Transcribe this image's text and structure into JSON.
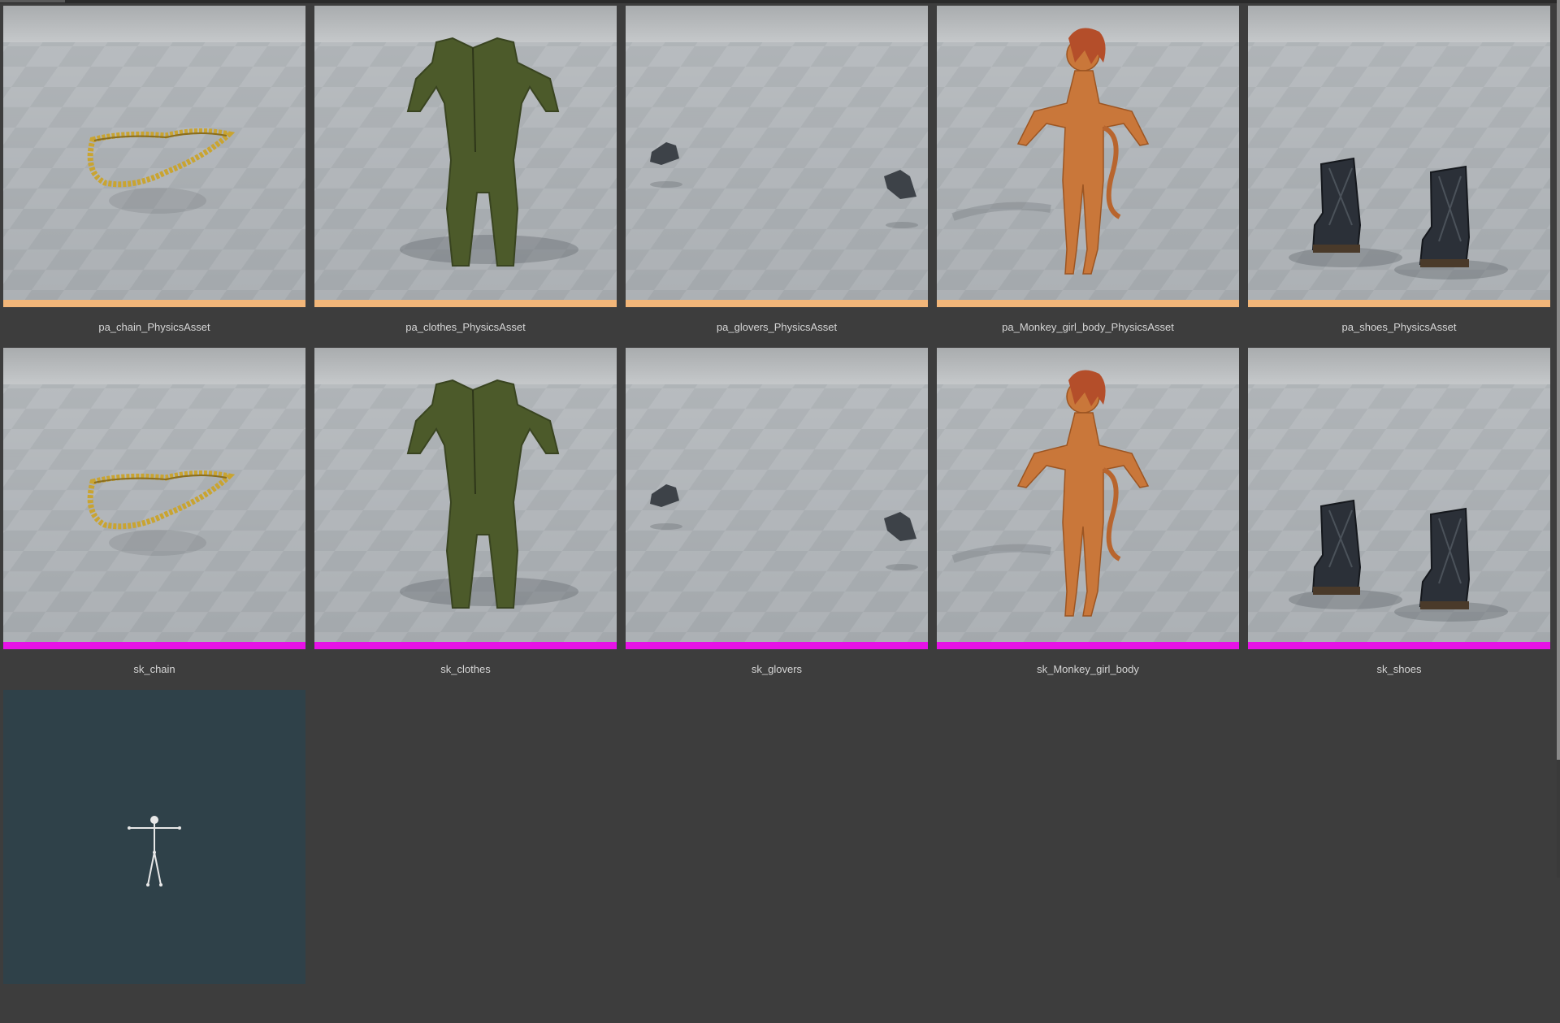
{
  "colors": {
    "physics_bar": "#f2b679",
    "mesh_bar": "#e612e6",
    "background": "#3d3d3d",
    "label_text": "#d6d6d6",
    "skeleton_bg": "#2f4149"
  },
  "assets": {
    "row1": [
      {
        "label": "pa_chain_PhysicsAsset",
        "type": "physics_asset",
        "preview": "chain"
      },
      {
        "label": "pa_clothes_PhysicsAsset",
        "type": "physics_asset",
        "preview": "jumpsuit"
      },
      {
        "label": "pa_glovers_PhysicsAsset",
        "type": "physics_asset",
        "preview": "gloves"
      },
      {
        "label": "pa_Monkey_girl_body_PhysicsAsset",
        "type": "physics_asset",
        "preview": "body"
      },
      {
        "label": "pa_shoes_PhysicsAsset",
        "type": "physics_asset",
        "preview": "boots"
      }
    ],
    "row2": [
      {
        "label": "sk_chain",
        "type": "skeletal_mesh",
        "preview": "chain"
      },
      {
        "label": "sk_clothes",
        "type": "skeletal_mesh",
        "preview": "jumpsuit"
      },
      {
        "label": "sk_glovers",
        "type": "skeletal_mesh",
        "preview": "gloves"
      },
      {
        "label": "sk_Monkey_girl_body",
        "type": "skeletal_mesh",
        "preview": "body"
      },
      {
        "label": "sk_shoes",
        "type": "skeletal_mesh",
        "preview": "boots"
      }
    ],
    "row3": [
      {
        "label": "",
        "type": "skeleton",
        "preview": "skeleton"
      }
    ]
  }
}
